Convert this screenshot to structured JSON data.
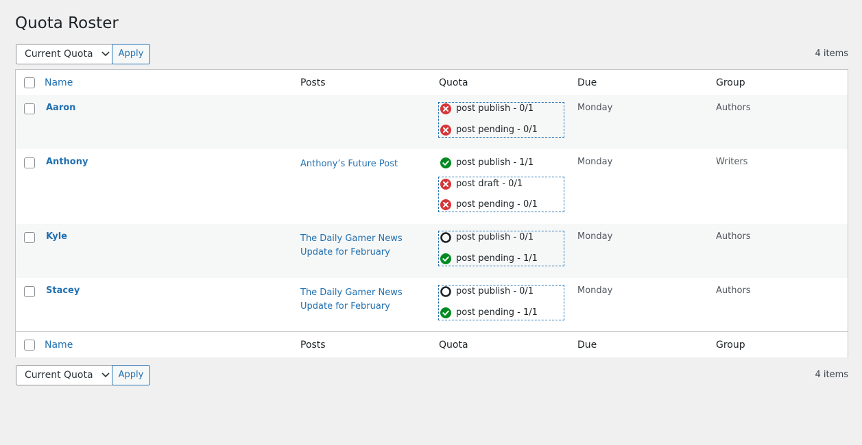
{
  "page": {
    "title": "Quota Roster"
  },
  "tablenav": {
    "select_value": "Current Quota",
    "apply_label": "Apply",
    "items_count": "4 items"
  },
  "columns": {
    "name": "Name",
    "posts": "Posts",
    "quota": "Quota",
    "due": "Due",
    "group": "Group"
  },
  "colors": {
    "link": "#2271b1",
    "fail": "#d63638",
    "success": "#008a20",
    "pending": "#1d2327"
  },
  "rows": [
    {
      "name": "Aaron",
      "post": "",
      "quota": [
        {
          "status": "fail",
          "icon": "x-circle-icon",
          "text": "post publish - 0/1"
        },
        {
          "status": "fail",
          "icon": "x-circle-icon",
          "text": "post pending - 0/1"
        }
      ],
      "due": "Monday",
      "group": "Authors"
    },
    {
      "name": "Anthony",
      "post": "Anthony’s Future Post",
      "quota": [
        {
          "status": "success",
          "icon": "check-circle-icon",
          "text": "post publish - 1/1"
        },
        {
          "status": "fail",
          "icon": "x-circle-icon",
          "text": "post draft - 0/1"
        },
        {
          "status": "fail",
          "icon": "x-circle-icon",
          "text": "post pending - 0/1"
        }
      ],
      "due": "Monday",
      "group": "Writers"
    },
    {
      "name": "Kyle",
      "post": "The Daily Gamer News Update for February",
      "quota": [
        {
          "status": "empty",
          "icon": "empty-circle-icon",
          "text": "post publish - 0/1"
        },
        {
          "status": "success",
          "icon": "check-circle-icon",
          "text": "post pending - 1/1"
        }
      ],
      "due": "Monday",
      "group": "Authors"
    },
    {
      "name": "Stacey",
      "post": "The Daily Gamer News Update for February",
      "quota": [
        {
          "status": "empty",
          "icon": "empty-circle-icon",
          "text": "post publish - 0/1"
        },
        {
          "status": "success",
          "icon": "check-circle-icon",
          "text": "post pending - 1/1"
        }
      ],
      "due": "Monday",
      "group": "Authors"
    }
  ]
}
